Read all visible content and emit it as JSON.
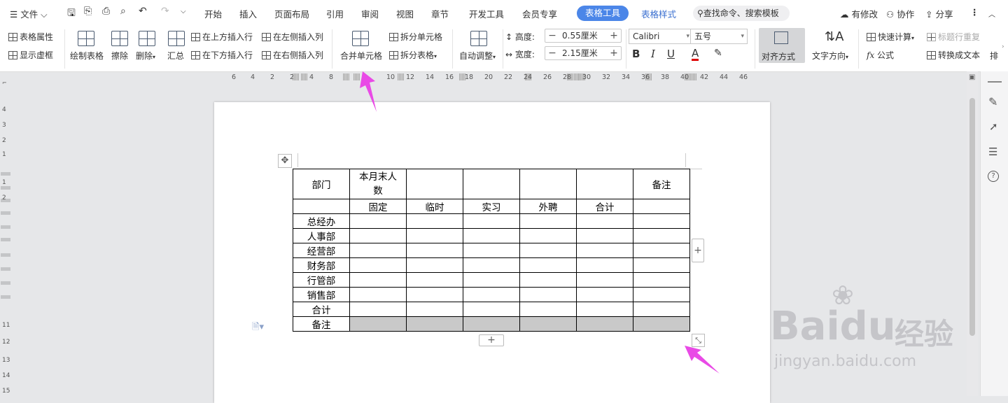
{
  "menubar": {
    "file_label": "文件",
    "tabs": [
      "开始",
      "插入",
      "页面布局",
      "引用",
      "审阅",
      "视图",
      "章节",
      "开发工具",
      "会员专享"
    ],
    "active_tab": "表格工具",
    "table_style_tab": "表格样式",
    "search_placeholder": "查找命令、搜索模板",
    "right": {
      "modify": "有修改",
      "collab": "协作",
      "share": "分享"
    }
  },
  "ribbon": {
    "table_props": "表格属性",
    "show_gridlines": "显示虚框",
    "draw_table": "绘制表格",
    "erase": "擦除",
    "delete": "删除",
    "summary": "汇总",
    "insert_above": "在上方插入行",
    "insert_below": "在下方插入行",
    "insert_left": "在左侧插入列",
    "insert_right": "在右侧插入列",
    "merge_cells": "合并单元格",
    "split_cells": "拆分单元格",
    "split_table": "拆分表格",
    "auto_fit": "自动调整",
    "height_label": "高度:",
    "height_value": "0.55厘米",
    "width_label": "宽度:",
    "width_value": "2.15厘米",
    "font_name": "Calibri",
    "font_size": "五号",
    "align": "对齐方式",
    "text_direction": "文字方向",
    "quick_calc": "快速计算",
    "repeat_header": "标题行重复",
    "formula": "公式",
    "convert_text": "转换成文本",
    "sort": "排"
  },
  "hruler_ticks": [
    "6",
    "4",
    "2",
    "2",
    "4",
    "8",
    "10",
    "12",
    "14",
    "16",
    "18",
    "20",
    "22",
    "24",
    "26",
    "28",
    "30",
    "32",
    "34",
    "36",
    "38",
    "40",
    "42",
    "44",
    "46"
  ],
  "vruler_ticks": [
    "4",
    "3",
    "2",
    "1",
    "1",
    "2",
    "11",
    "12",
    "13",
    "14",
    "15"
  ],
  "table": {
    "rows": [
      [
        "部门",
        "本月末人数",
        "",
        "",
        "",
        "",
        "备注"
      ],
      [
        "",
        "固定",
        "临时",
        "实习",
        "外聘",
        "合计",
        ""
      ],
      [
        "总经办",
        "",
        "",
        "",
        "",
        "",
        ""
      ],
      [
        "人事部",
        "",
        "",
        "",
        "",
        "",
        ""
      ],
      [
        "经营部",
        "",
        "",
        "",
        "",
        "",
        ""
      ],
      [
        "财务部",
        "",
        "",
        "",
        "",
        "",
        ""
      ],
      [
        "行管部",
        "",
        "",
        "",
        "",
        "",
        ""
      ],
      [
        "销售部",
        "",
        "",
        "",
        "",
        "",
        ""
      ],
      [
        "合计",
        "",
        "",
        "",
        "",
        "",
        ""
      ],
      [
        "备注",
        "",
        "",
        "",
        "",
        "",
        ""
      ]
    ],
    "selected_row": 9
  },
  "controls": {
    "add_row": "+",
    "add_col": "+"
  },
  "colors": {
    "accent": "#4b86e8",
    "arrow": "#e94ae6",
    "selection": "#c9c9c9"
  },
  "watermark": {
    "brand": "Baidu",
    "brand_cn": "经验",
    "url": "jingyan.baidu.com"
  }
}
